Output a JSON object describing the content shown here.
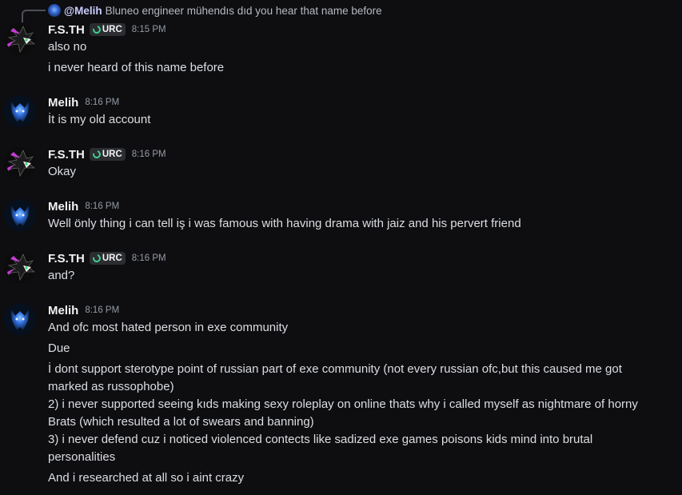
{
  "reply": {
    "mention": "@Melih",
    "text": "Bluneo engineer mühendıs dıd you hear that name before"
  },
  "messages": [
    {
      "author": "F.S.TH",
      "badge": "URC",
      "time": "8:15 PM",
      "lines": [
        "also no",
        "i never heard of this name before"
      ]
    },
    {
      "author": "Melih",
      "time": "8:16 PM",
      "lines": [
        "İt is my old account"
      ]
    },
    {
      "author": "F.S.TH",
      "badge": "URC",
      "time": "8:16 PM",
      "lines": [
        "Okay"
      ]
    },
    {
      "author": "Melih",
      "time": "8:16 PM",
      "lines": [
        "Well önly thing i can tell iş i was famous with having drama with jaiz and his pervert friend"
      ]
    },
    {
      "author": "F.S.TH",
      "badge": "URC",
      "time": "8:16 PM",
      "lines": [
        "and?"
      ]
    },
    {
      "author": "Melih",
      "time": "8:16 PM",
      "lines": [
        "And ofc most hated person in exe community",
        "Due",
        "İ dont support sterotype point of russian part of exe community (not every russian ofc,but this caused me got marked as russophobe)\n2) i never supported seeing kıds making sexy roleplay on online thats why i called myself as nightmare of horny Brats (which resulted a lot of swears and banning)\n3) i never defend cuz i noticed violenced contects like sadized exe games poisons kids mind into brutal personalities",
        "And i researched at all so i aint crazy"
      ]
    }
  ],
  "colors": {
    "background": "#0e0e11",
    "text": "#dbdee1",
    "username": "#f2f3f5",
    "timestamp": "#949ba4",
    "badge_bg": "#2b2d31",
    "badge_icon": "#3ed08b",
    "mention": "#c9cdfb"
  },
  "icons": {
    "fsth_avatar": "purple-hedgehog-avatar-icon",
    "melih_avatar": "blue-wolf-avatar-icon",
    "badge": "crescent-moon-icon"
  }
}
